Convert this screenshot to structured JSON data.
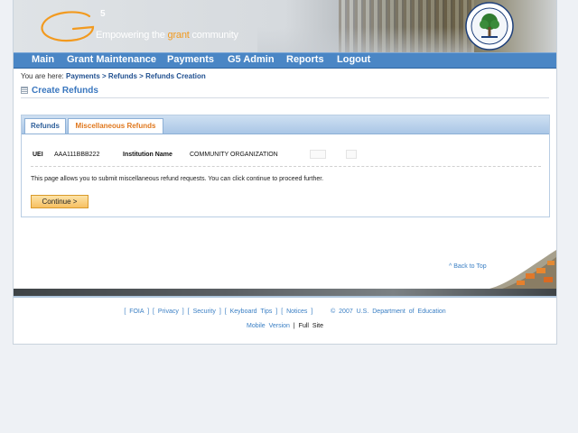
{
  "header": {
    "logo_letter": "G",
    "logo_superscript": "5",
    "tagline_pre": "Empowering the ",
    "tagline_grant": "grant",
    "tagline_post": " community"
  },
  "nav": {
    "items": [
      {
        "label": "Main"
      },
      {
        "label": "Grant Maintenance"
      },
      {
        "label": "Payments"
      },
      {
        "label": "G5 Admin"
      },
      {
        "label": "Reports"
      },
      {
        "label": "Logout"
      }
    ]
  },
  "breadcrumb": {
    "prefix": "You are here:",
    "crumbs": [
      "Payments",
      "Refunds",
      "Refunds Creation"
    ],
    "sep": ">"
  },
  "page": {
    "title": "Create Refunds"
  },
  "tabs": {
    "refunds": "Refunds",
    "misc": "Miscellaneous Refunds"
  },
  "info": {
    "uei_label": "UEI",
    "uei_value": "AAA111BBB222",
    "inst_label": "Institution Name",
    "inst_value": "COMMUNITY ORGANIZATION"
  },
  "description": "This page allows you to submit miscellaneous refund requests. You can click continue to proceed further.",
  "continue_label": "Continue >",
  "back_to_top": "^ Back to Top",
  "footer": {
    "links": [
      "FOIA",
      "Privacy",
      "Security",
      "Keyboard Tips",
      "Notices"
    ],
    "copyright": "© 2007 U.S. Department of Education",
    "mobile": "Mobile Version",
    "separator": "|",
    "full": "Full Site"
  },
  "colors": {
    "nav_bg": "#4a86c5",
    "title_blue": "#3a77bf",
    "accent_orange": "#f29a1f",
    "tab_active": "#e0781e"
  }
}
